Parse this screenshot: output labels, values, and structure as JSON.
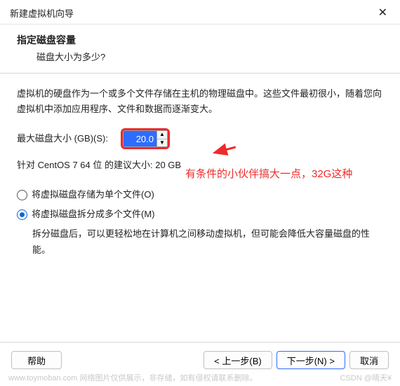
{
  "window": {
    "title": "新建虚拟机向导",
    "close_icon": "✕"
  },
  "header": {
    "title": "指定磁盘容量",
    "subtitle": "磁盘大小为多少?"
  },
  "body": {
    "description": "虚拟机的硬盘作为一个或多个文件存储在主机的物理磁盘中。这些文件最初很小，随着您向虚拟机中添加应用程序、文件和数据而逐渐变大。",
    "size_label": "最大磁盘大小 (GB)(S):",
    "size_value": "20.0",
    "spin_up": "▲",
    "spin_down": "▼",
    "recommend": "针对 CentOS 7 64 位 的建议大小: 20 GB",
    "annotation": "有条件的小伙伴搞大一点，32G这种",
    "radio_single": "将虚拟磁盘存储为单个文件(O)",
    "radio_split": "将虚拟磁盘拆分成多个文件(M)",
    "split_note": "拆分磁盘后，可以更轻松地在计算机之间移动虚拟机，但可能会降低大容量磁盘的性能。"
  },
  "footer": {
    "help": "帮助",
    "back": "< 上一步(B)",
    "next": "下一步(N) >",
    "cancel": "取消"
  },
  "watermark": {
    "left": "www.toymoban.com  网络图片仅供展示，非存储，如有侵权请联系删除。",
    "right": "CSDN @晴天¥"
  }
}
